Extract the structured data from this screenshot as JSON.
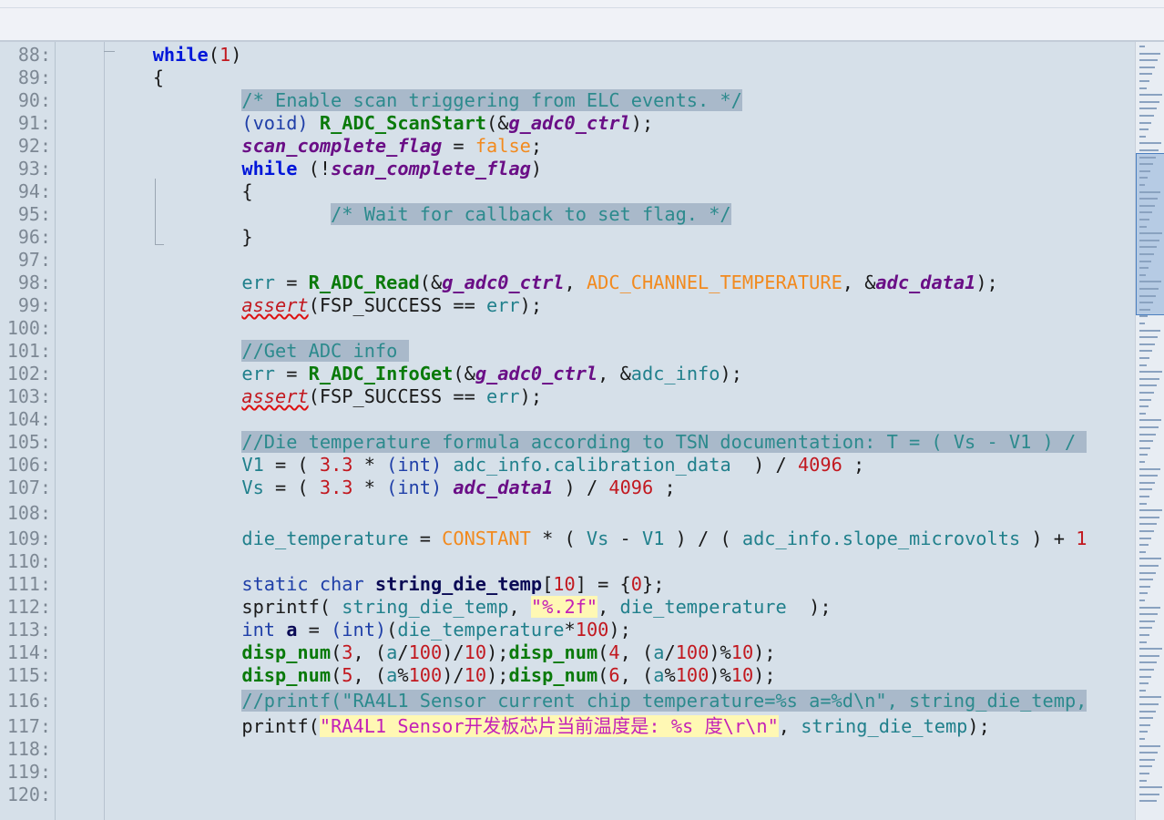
{
  "editor": {
    "lines": [
      {
        "n": "88:",
        "indent": "    ",
        "tokens": [
          {
            "t": "while",
            "c": "kw"
          },
          {
            "t": "(",
            "c": ""
          },
          {
            "t": "1",
            "c": "num"
          },
          {
            "t": ")",
            "c": ""
          }
        ]
      },
      {
        "n": "89:",
        "indent": "    ",
        "tokens": [
          {
            "t": "{",
            "c": ""
          }
        ]
      },
      {
        "n": "90:",
        "indent": "        ",
        "tokens": [
          {
            "t": "/* Enable scan triggering from ELC events. */",
            "c": "cm"
          }
        ]
      },
      {
        "n": "91:",
        "indent": "        ",
        "tokens": [
          {
            "t": "(void) ",
            "c": "ty"
          },
          {
            "t": "R_ADC_ScanStart",
            "c": "fn"
          },
          {
            "t": "(&",
            "c": ""
          },
          {
            "t": "g_adc0_ctrl",
            "c": "var"
          },
          {
            "t": ");",
            "c": ""
          }
        ]
      },
      {
        "n": "92:",
        "indent": "        ",
        "tokens": [
          {
            "t": "scan_complete_flag",
            "c": "var"
          },
          {
            "t": " = ",
            "c": ""
          },
          {
            "t": "false",
            "c": "mac"
          },
          {
            "t": ";",
            "c": ""
          }
        ]
      },
      {
        "n": "93:",
        "indent": "        ",
        "tokens": [
          {
            "t": "while",
            "c": "kw"
          },
          {
            "t": " (!",
            "c": ""
          },
          {
            "t": "scan_complete_flag",
            "c": "var"
          },
          {
            "t": ")",
            "c": ""
          }
        ]
      },
      {
        "n": "94:",
        "indent": "        ",
        "tokens": [
          {
            "t": "{",
            "c": ""
          }
        ]
      },
      {
        "n": "95:",
        "indent": "            ",
        "tokens": [
          {
            "t": "/* Wait for callback to set flag. */",
            "c": "cm"
          }
        ]
      },
      {
        "n": "96:",
        "indent": "        ",
        "tokens": [
          {
            "t": "}",
            "c": ""
          }
        ]
      },
      {
        "n": "97:",
        "indent": "",
        "tokens": []
      },
      {
        "n": "98:",
        "indent": "        ",
        "tokens": [
          {
            "t": "err",
            "c": "id"
          },
          {
            "t": " = ",
            "c": ""
          },
          {
            "t": "R_ADC_Read",
            "c": "fn"
          },
          {
            "t": "(&",
            "c": ""
          },
          {
            "t": "g_adc0_ctrl",
            "c": "var"
          },
          {
            "t": ", ",
            "c": ""
          },
          {
            "t": "ADC_CHANNEL_TEMPERATURE",
            "c": "mac"
          },
          {
            "t": ", &",
            "c": ""
          },
          {
            "t": "adc_data1",
            "c": "var"
          },
          {
            "t": ");",
            "c": ""
          }
        ]
      },
      {
        "n": "99:",
        "indent": "        ",
        "tokens": [
          {
            "t": "assert",
            "c": "err"
          },
          {
            "t": "(FSP_SUCCESS == ",
            "c": ""
          },
          {
            "t": "err",
            "c": "id"
          },
          {
            "t": ");",
            "c": ""
          }
        ]
      },
      {
        "n": "100:",
        "indent": "",
        "tokens": []
      },
      {
        "n": "101:",
        "indent": "        ",
        "tokens": [
          {
            "t": "//Get ADC info ",
            "c": "cm"
          }
        ]
      },
      {
        "n": "102:",
        "indent": "        ",
        "tokens": [
          {
            "t": "err",
            "c": "id"
          },
          {
            "t": " = ",
            "c": ""
          },
          {
            "t": "R_ADC_InfoGet",
            "c": "fn"
          },
          {
            "t": "(&",
            "c": ""
          },
          {
            "t": "g_adc0_ctrl",
            "c": "var"
          },
          {
            "t": ", &",
            "c": ""
          },
          {
            "t": "adc_info",
            "c": "id"
          },
          {
            "t": ");",
            "c": ""
          }
        ]
      },
      {
        "n": "103:",
        "indent": "        ",
        "tokens": [
          {
            "t": "assert",
            "c": "err"
          },
          {
            "t": "(FSP_SUCCESS == ",
            "c": ""
          },
          {
            "t": "err",
            "c": "id"
          },
          {
            "t": ");",
            "c": ""
          }
        ]
      },
      {
        "n": "104:",
        "indent": "",
        "tokens": []
      },
      {
        "n": "105:",
        "indent": "        ",
        "tokens": [
          {
            "t": "//Die temperature formula according to TSN documentation: T = ( Vs - V1 ) / ",
            "c": "cm"
          }
        ]
      },
      {
        "n": "106:",
        "indent": "        ",
        "tokens": [
          {
            "t": "V1",
            "c": "id"
          },
          {
            "t": " = ( ",
            "c": ""
          },
          {
            "t": "3.3",
            "c": "num"
          },
          {
            "t": " * ",
            "c": ""
          },
          {
            "t": "(int)",
            "c": "ty"
          },
          {
            "t": " ",
            "c": ""
          },
          {
            "t": "adc_info.calibration_data",
            "c": "id"
          },
          {
            "t": "  ) / ",
            "c": ""
          },
          {
            "t": "4096",
            "c": "num"
          },
          {
            "t": " ;",
            "c": ""
          }
        ]
      },
      {
        "n": "107:",
        "indent": "        ",
        "tokens": [
          {
            "t": "Vs",
            "c": "id"
          },
          {
            "t": " = ( ",
            "c": ""
          },
          {
            "t": "3.3",
            "c": "num"
          },
          {
            "t": " * ",
            "c": ""
          },
          {
            "t": "(int)",
            "c": "ty"
          },
          {
            "t": " ",
            "c": ""
          },
          {
            "t": "adc_data1",
            "c": "var"
          },
          {
            "t": " ) / ",
            "c": ""
          },
          {
            "t": "4096",
            "c": "num"
          },
          {
            "t": " ;",
            "c": ""
          }
        ]
      },
      {
        "n": "108:",
        "indent": "",
        "tokens": []
      },
      {
        "n": "109:",
        "indent": "        ",
        "tokens": [
          {
            "t": "die_temperature",
            "c": "id"
          },
          {
            "t": " = ",
            "c": ""
          },
          {
            "t": "CONSTANT",
            "c": "mac"
          },
          {
            "t": " * ( ",
            "c": ""
          },
          {
            "t": "Vs",
            "c": "id"
          },
          {
            "t": " - ",
            "c": ""
          },
          {
            "t": "V1",
            "c": "id"
          },
          {
            "t": " ) / ( ",
            "c": ""
          },
          {
            "t": "adc_info.slope_microvolts",
            "c": "id"
          },
          {
            "t": " ) + ",
            "c": ""
          },
          {
            "t": "1",
            "c": "num"
          }
        ]
      },
      {
        "n": "110:",
        "indent": "",
        "tokens": []
      },
      {
        "n": "111:",
        "indent": "        ",
        "tokens": [
          {
            "t": "static char ",
            "c": "ty"
          },
          {
            "t": "string_die_temp",
            "c": "bold"
          },
          {
            "t": "[",
            "c": ""
          },
          {
            "t": "10",
            "c": "num"
          },
          {
            "t": "] = {",
            "c": ""
          },
          {
            "t": "0",
            "c": "num"
          },
          {
            "t": "};",
            "c": ""
          }
        ]
      },
      {
        "n": "112:",
        "indent": "        ",
        "tokens": [
          {
            "t": "sprintf",
            "c": ""
          },
          {
            "t": "( ",
            "c": ""
          },
          {
            "t": "string_die_temp",
            "c": "id"
          },
          {
            "t": ", ",
            "c": ""
          },
          {
            "t": "\"%.2f\"",
            "c": "str"
          },
          {
            "t": ", ",
            "c": ""
          },
          {
            "t": "die_temperature",
            "c": "id"
          },
          {
            "t": "  );",
            "c": ""
          }
        ]
      },
      {
        "n": "113:",
        "indent": "        ",
        "tokens": [
          {
            "t": "int ",
            "c": "ty"
          },
          {
            "t": "a",
            "c": "bold"
          },
          {
            "t": " = ",
            "c": ""
          },
          {
            "t": "(int)",
            "c": "ty"
          },
          {
            "t": "(",
            "c": ""
          },
          {
            "t": "die_temperature",
            "c": "id"
          },
          {
            "t": "*",
            "c": ""
          },
          {
            "t": "100",
            "c": "num"
          },
          {
            "t": ");",
            "c": ""
          }
        ]
      },
      {
        "n": "114:",
        "indent": "        ",
        "tokens": [
          {
            "t": "disp_num",
            "c": "fn"
          },
          {
            "t": "(",
            "c": ""
          },
          {
            "t": "3",
            "c": "num"
          },
          {
            "t": ", (",
            "c": ""
          },
          {
            "t": "a",
            "c": "id"
          },
          {
            "t": "/",
            "c": ""
          },
          {
            "t": "100",
            "c": "num"
          },
          {
            "t": ")/",
            "c": ""
          },
          {
            "t": "10",
            "c": "num"
          },
          {
            "t": ");",
            "c": ""
          },
          {
            "t": "disp_num",
            "c": "fn"
          },
          {
            "t": "(",
            "c": ""
          },
          {
            "t": "4",
            "c": "num"
          },
          {
            "t": ", (",
            "c": ""
          },
          {
            "t": "a",
            "c": "id"
          },
          {
            "t": "/",
            "c": ""
          },
          {
            "t": "100",
            "c": "num"
          },
          {
            "t": ")%",
            "c": ""
          },
          {
            "t": "10",
            "c": "num"
          },
          {
            "t": ");",
            "c": ""
          }
        ]
      },
      {
        "n": "115:",
        "indent": "        ",
        "tokens": [
          {
            "t": "disp_num",
            "c": "fn"
          },
          {
            "t": "(",
            "c": ""
          },
          {
            "t": "5",
            "c": "num"
          },
          {
            "t": ", (",
            "c": ""
          },
          {
            "t": "a",
            "c": "id"
          },
          {
            "t": "%",
            "c": ""
          },
          {
            "t": "100",
            "c": "num"
          },
          {
            "t": ")/",
            "c": ""
          },
          {
            "t": "10",
            "c": "num"
          },
          {
            "t": ");",
            "c": ""
          },
          {
            "t": "disp_num",
            "c": "fn"
          },
          {
            "t": "(",
            "c": ""
          },
          {
            "t": "6",
            "c": "num"
          },
          {
            "t": ", (",
            "c": ""
          },
          {
            "t": "a",
            "c": "id"
          },
          {
            "t": "%",
            "c": ""
          },
          {
            "t": "100",
            "c": "num"
          },
          {
            "t": ")%",
            "c": ""
          },
          {
            "t": "10",
            "c": "num"
          },
          {
            "t": ");",
            "c": ""
          }
        ]
      },
      {
        "n": "116:",
        "indent": "        ",
        "tokens": [
          {
            "t": "//printf(\"RA4L1 Sensor current chip temperature=%s a=%d\\n\", string_die_temp,",
            "c": "cm"
          }
        ]
      },
      {
        "n": "117:",
        "indent": "        ",
        "tokens": [
          {
            "t": "printf",
            "c": ""
          },
          {
            "t": "(",
            "c": ""
          },
          {
            "t": "\"RA4L1 Sensor开发板芯片当前温度是: %s 度\\r\\n\"",
            "c": "str"
          },
          {
            "t": ", ",
            "c": ""
          },
          {
            "t": "string_die_temp",
            "c": "id"
          },
          {
            "t": ");",
            "c": ""
          }
        ]
      },
      {
        "n": "118:",
        "indent": "",
        "tokens": []
      },
      {
        "n": "119:",
        "indent": "",
        "tokens": []
      },
      {
        "n": "120:",
        "indent": "",
        "tokens": []
      }
    ]
  },
  "colors": {
    "background": "#d6e0e9",
    "keyword": "#0016d9",
    "function": "#0a7a0a",
    "variable": "#6a0e86",
    "number": "#c2181f",
    "macro": "#f28a1e",
    "comment_bg": "#a9b9ca",
    "string_bg": "#fff8b4"
  }
}
